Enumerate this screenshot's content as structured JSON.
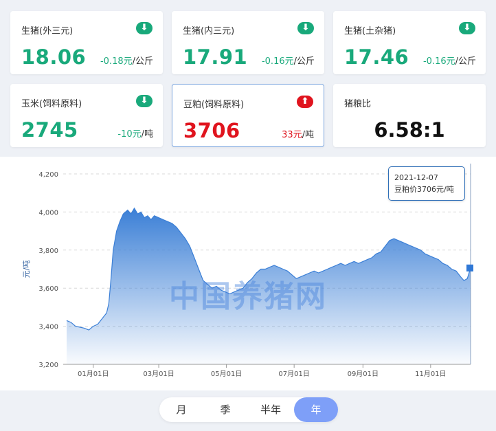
{
  "cards": [
    {
      "title": "生猪(外三元)",
      "price": "18.06",
      "change": "-0.18元",
      "unit": "/公斤",
      "direction": "down"
    },
    {
      "title": "生猪(内三元)",
      "price": "17.91",
      "change": "-0.16元",
      "unit": "/公斤",
      "direction": "down"
    },
    {
      "title": "生猪(土杂猪)",
      "price": "17.46",
      "change": "-0.16元",
      "unit": "/公斤",
      "direction": "down"
    },
    {
      "title": "玉米(饲料原料)",
      "price": "2745",
      "change": "-10元",
      "unit": "/吨",
      "direction": "down"
    },
    {
      "title": "豆粕(饲料原料)",
      "price": "3706",
      "change": "33元",
      "unit": "/吨",
      "direction": "up"
    },
    {
      "title": "猪粮比",
      "ratio": "6.58:1"
    }
  ],
  "colors": {
    "down": "#19a97b",
    "up": "#e0141e",
    "line": "#3b7fd6",
    "active_tab": "#7e9ff8"
  },
  "watermark": "中国养猪网",
  "tooltip": {
    "date": "2021-12-07",
    "label": "豆粕价3706元/吨"
  },
  "periods": [
    "月",
    "季",
    "半年",
    "年"
  ],
  "active_period": "年",
  "chart_data": {
    "type": "area",
    "title": "",
    "xlabel": "",
    "ylabel": "元/吨",
    "ylim": [
      3200,
      4200
    ],
    "yticks": [
      3200,
      3400,
      3600,
      3800,
      4000,
      4200
    ],
    "ytick_labels": [
      "3,200",
      "3,400",
      "3,600",
      "3,800",
      "4,000",
      "4,200"
    ],
    "xtick_labels": [
      "01月01日",
      "03月01日",
      "05月01日",
      "07月01日",
      "09月01日",
      "11月01日"
    ],
    "xticks": [
      "2021-01-01",
      "2021-03-01",
      "2021-05-01",
      "2021-07-01",
      "2021-09-01",
      "2021-11-01"
    ],
    "grid": true,
    "series": [
      {
        "values": [
          [
            "2020-12-08",
            3430
          ],
          [
            "2020-12-12",
            3420
          ],
          [
            "2020-12-16",
            3400
          ],
          [
            "2020-12-20",
            3395
          ],
          [
            "2020-12-24",
            3390
          ],
          [
            "2020-12-28",
            3380
          ],
          [
            "2021-01-01",
            3400
          ],
          [
            "2021-01-05",
            3410
          ],
          [
            "2021-01-09",
            3440
          ],
          [
            "2021-01-13",
            3470
          ],
          [
            "2021-01-15",
            3520
          ],
          [
            "2021-01-17",
            3650
          ],
          [
            "2021-01-19",
            3800
          ],
          [
            "2021-01-22",
            3900
          ],
          [
            "2021-01-25",
            3950
          ],
          [
            "2021-01-28",
            3990
          ],
          [
            "2021-02-01",
            4010
          ],
          [
            "2021-02-04",
            3990
          ],
          [
            "2021-02-07",
            4020
          ],
          [
            "2021-02-10",
            3990
          ],
          [
            "2021-02-13",
            4000
          ],
          [
            "2021-02-16",
            3970
          ],
          [
            "2021-02-19",
            3980
          ],
          [
            "2021-02-22",
            3960
          ],
          [
            "2021-02-25",
            3980
          ],
          [
            "2021-03-01",
            3970
          ],
          [
            "2021-03-05",
            3960
          ],
          [
            "2021-03-09",
            3950
          ],
          [
            "2021-03-13",
            3940
          ],
          [
            "2021-03-17",
            3920
          ],
          [
            "2021-03-21",
            3890
          ],
          [
            "2021-03-25",
            3860
          ],
          [
            "2021-03-29",
            3820
          ],
          [
            "2021-04-02",
            3760
          ],
          [
            "2021-04-06",
            3700
          ],
          [
            "2021-04-10",
            3640
          ],
          [
            "2021-04-14",
            3620
          ],
          [
            "2021-04-18",
            3600
          ],
          [
            "2021-04-22",
            3610
          ],
          [
            "2021-04-26",
            3590
          ],
          [
            "2021-04-30",
            3580
          ],
          [
            "2021-05-04",
            3570
          ],
          [
            "2021-05-08",
            3580
          ],
          [
            "2021-05-12",
            3590
          ],
          [
            "2021-05-16",
            3600
          ],
          [
            "2021-05-20",
            3630
          ],
          [
            "2021-05-24",
            3650
          ],
          [
            "2021-05-28",
            3680
          ],
          [
            "2021-06-01",
            3700
          ],
          [
            "2021-06-05",
            3700
          ],
          [
            "2021-06-09",
            3710
          ],
          [
            "2021-06-13",
            3720
          ],
          [
            "2021-06-17",
            3710
          ],
          [
            "2021-06-21",
            3700
          ],
          [
            "2021-06-25",
            3690
          ],
          [
            "2021-06-29",
            3670
          ],
          [
            "2021-07-03",
            3650
          ],
          [
            "2021-07-07",
            3660
          ],
          [
            "2021-07-11",
            3670
          ],
          [
            "2021-07-15",
            3680
          ],
          [
            "2021-07-19",
            3690
          ],
          [
            "2021-07-23",
            3680
          ],
          [
            "2021-07-27",
            3690
          ],
          [
            "2021-07-31",
            3700
          ],
          [
            "2021-08-04",
            3710
          ],
          [
            "2021-08-08",
            3720
          ],
          [
            "2021-08-12",
            3730
          ],
          [
            "2021-08-16",
            3720
          ],
          [
            "2021-08-20",
            3730
          ],
          [
            "2021-08-24",
            3740
          ],
          [
            "2021-08-28",
            3730
          ],
          [
            "2021-09-01",
            3740
          ],
          [
            "2021-09-05",
            3750
          ],
          [
            "2021-09-09",
            3760
          ],
          [
            "2021-09-13",
            3780
          ],
          [
            "2021-09-17",
            3790
          ],
          [
            "2021-09-21",
            3820
          ],
          [
            "2021-09-25",
            3850
          ],
          [
            "2021-09-29",
            3860
          ],
          [
            "2021-10-03",
            3850
          ],
          [
            "2021-10-07",
            3840
          ],
          [
            "2021-10-11",
            3830
          ],
          [
            "2021-10-15",
            3820
          ],
          [
            "2021-10-19",
            3810
          ],
          [
            "2021-10-23",
            3800
          ],
          [
            "2021-10-27",
            3780
          ],
          [
            "2021-10-31",
            3770
          ],
          [
            "2021-11-04",
            3760
          ],
          [
            "2021-11-08",
            3750
          ],
          [
            "2021-11-12",
            3730
          ],
          [
            "2021-11-16",
            3720
          ],
          [
            "2021-11-20",
            3700
          ],
          [
            "2021-11-24",
            3690
          ],
          [
            "2021-11-28",
            3660
          ],
          [
            "2021-12-01",
            3640
          ],
          [
            "2021-12-04",
            3650
          ],
          [
            "2021-12-07",
            3706
          ]
        ]
      }
    ]
  }
}
